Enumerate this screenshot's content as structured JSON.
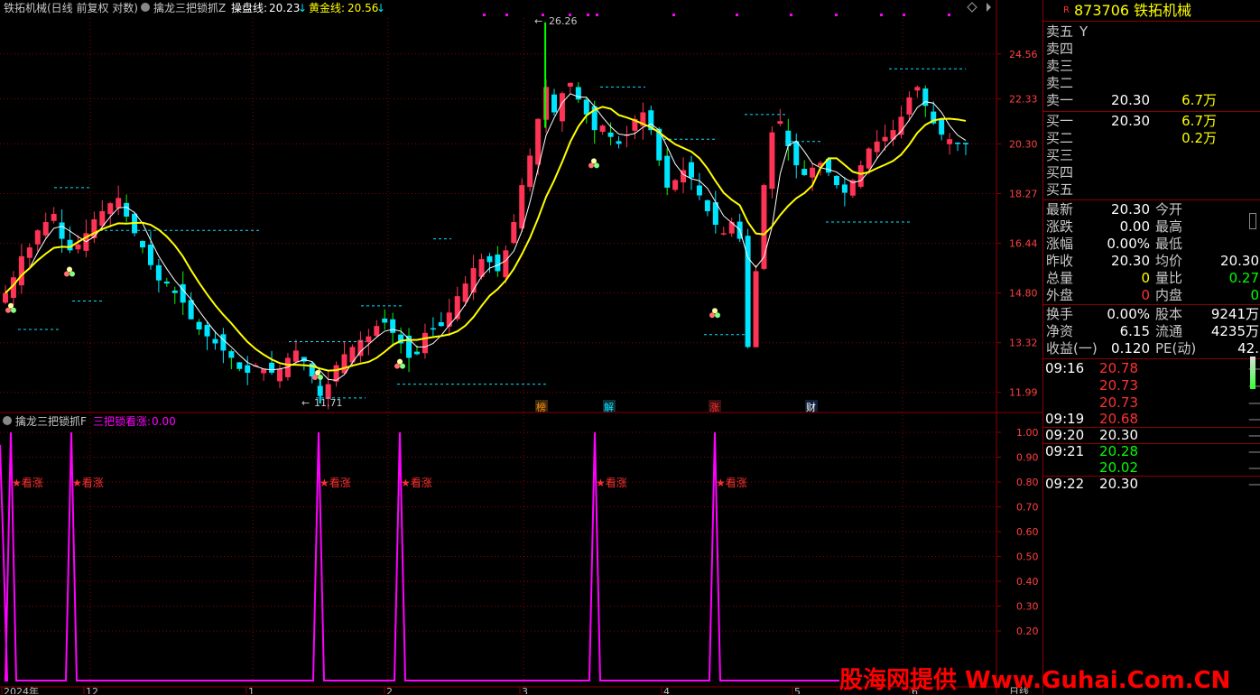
{
  "header": {
    "stock_title": "铁拓机械(日线 前复权 对数)",
    "indicator_name": "擒龙三把锁抓Z",
    "line1_label": "操盘线: ",
    "line1_value": "20.23",
    "line1_arrow": "↓",
    "line2_label": "黄金线: ",
    "line2_value": "20.56",
    "line2_arrow": "↓",
    "diamond_icon": "diamond-icon"
  },
  "sub_header": {
    "indicator_name": "擒龙三把锁抓F",
    "series_label": "三把锁看涨: ",
    "series_value": "0.00"
  },
  "price_axis": {
    "ticks": [
      "24.56",
      "22.33",
      "20.30",
      "18.27",
      "16.44",
      "14.80",
      "13.32",
      "11.99"
    ]
  },
  "sub_axis": {
    "ticks": [
      "1.00",
      "0.90",
      "0.80",
      "0.70",
      "0.60",
      "0.50",
      "0.40",
      "0.30",
      "0.20"
    ]
  },
  "annotations": {
    "high_label": "26.26",
    "low_label": "11.71",
    "events": [
      {
        "text": "榜",
        "color": "#ff8c00"
      },
      {
        "text": "解",
        "color": "#00e5ff"
      },
      {
        "text": "涨",
        "color": "#ff3030"
      },
      {
        "text": "财",
        "color": "#ffffff"
      }
    ],
    "signal_text": "★看涨"
  },
  "date_axis": {
    "labels": [
      "2024年",
      "12",
      "1",
      "2",
      "3",
      "4",
      "5",
      "6"
    ],
    "period": "日线"
  },
  "quote": {
    "badge": "R",
    "code": "873706",
    "name": "铁拓机械",
    "sell": [
      {
        "label": "卖五",
        "price": "",
        "vol": "",
        "extra": "Y"
      },
      {
        "label": "卖四",
        "price": "",
        "vol": ""
      },
      {
        "label": "卖三",
        "price": "",
        "vol": ""
      },
      {
        "label": "卖二",
        "price": "",
        "vol": ""
      },
      {
        "label": "卖一",
        "price": "20.30",
        "vol": "6.7万"
      }
    ],
    "buy": [
      {
        "label": "买一",
        "price": "20.30",
        "vol": "6.7万"
      },
      {
        "label": "买二",
        "price": "",
        "vol": "0.2万"
      },
      {
        "label": "买三",
        "price": "",
        "vol": ""
      },
      {
        "label": "买四",
        "price": "",
        "vol": ""
      },
      {
        "label": "买五",
        "price": "",
        "vol": ""
      }
    ],
    "stats": [
      {
        "l1": "最新",
        "v1": "20.30",
        "l2": "今开",
        "v2": ""
      },
      {
        "l1": "涨跌",
        "v1": "0.00",
        "l2": "最高",
        "v2": ""
      },
      {
        "l1": "涨幅",
        "v1": "0.00%",
        "l2": "最低",
        "v2": ""
      },
      {
        "l1": "昨收",
        "v1": "20.30",
        "l2": "均价",
        "v2": "20.30"
      },
      {
        "l1": "总量",
        "v1": "0",
        "l2": "量比",
        "v2": "0.27"
      },
      {
        "l1": "外盘",
        "v1": "0",
        "l2": "内盘",
        "v2": "0"
      }
    ],
    "stats2": [
      {
        "l1": "换手",
        "v1": "0.00%",
        "l2": "股本",
        "v2": "9241万"
      },
      {
        "l1": "净资",
        "v1": "6.15",
        "l2": "流通",
        "v2": "4235万"
      },
      {
        "l1": "收益(一)",
        "v1": "0.120",
        "l2": "PE(动)",
        "v2": "42."
      }
    ],
    "ticks": [
      {
        "time": "09:16",
        "price": "20.78"
      },
      {
        "time": "",
        "price": "20.73"
      },
      {
        "time": "",
        "price": "20.73"
      },
      {
        "time": "09:19",
        "price": "20.68"
      },
      {
        "time": "09:20",
        "price": "20.30"
      },
      {
        "time": "09:21",
        "price": "20.28"
      },
      {
        "time": "",
        "price": "20.02"
      },
      {
        "time": "09:22",
        "price": "20.30"
      }
    ]
  },
  "watermark": "股海网提供 Www.Guhai.Com.CN",
  "colors": {
    "up": "#ff3355",
    "down": "#00e5ff",
    "yellow": "#ffff00",
    "magenta": "#ff00ff",
    "red_text": "#ff3030",
    "green_text": "#00ff00",
    "grid": "#8b0000"
  },
  "chart_data": [
    {
      "type": "candlestick",
      "title": "擒龙三把锁抓Z",
      "scale": "log",
      "ylim": [
        11.6,
        26.5
      ],
      "y_ticks": [
        24.56,
        22.33,
        20.3,
        18.27,
        16.44,
        14.8,
        13.32,
        11.99
      ],
      "high_marker": 26.26,
      "low_marker": 11.71,
      "close_approx": [
        14.8,
        15.3,
        16.0,
        16.3,
        16.9,
        17.2,
        17.5,
        16.6,
        16.2,
        16.4,
        16.8,
        17.3,
        17.6,
        17.9,
        18.1,
        17.4,
        16.8,
        16.3,
        15.7,
        15.2,
        15.1,
        14.8,
        14.5,
        14.0,
        13.7,
        13.5,
        13.3,
        13.1,
        12.9,
        12.6,
        12.5,
        12.7,
        12.6,
        12.5,
        12.6,
        12.9,
        13.1,
        12.8,
        12.4,
        11.9,
        12.2,
        12.7,
        13.0,
        13.2,
        13.4,
        13.5,
        13.8,
        13.9,
        13.6,
        13.3,
        12.9,
        13.0,
        13.6,
        13.7,
        13.8,
        14.2,
        14.7,
        15.1,
        15.6,
        15.9,
        15.8,
        15.5,
        16.2,
        17.2,
        18.6,
        19.8,
        21.4,
        22.9,
        21.7,
        22.6,
        23.1,
        22.3,
        21.6,
        20.9,
        21.1,
        20.6,
        20.3,
        20.7,
        21.4,
        21.7,
        20.9,
        19.6,
        18.5,
        18.8,
        19.2,
        18.9,
        18.2,
        17.6,
        17.1,
        16.8,
        17.2,
        16.6,
        13.2,
        15.5,
        18.6,
        20.8,
        21.3,
        20.2,
        19.4,
        19.0,
        19.3,
        19.5,
        19.1,
        18.6,
        18.3,
        18.8,
        19.4,
        20.1,
        20.4,
        20.6,
        20.9,
        21.5,
        22.4,
        22.9,
        22.0,
        21.2,
        20.7,
        20.5,
        20.3,
        20.3
      ],
      "series": [
        {
          "name": "操盘线",
          "color": "#ffffff",
          "last": 20.23
        },
        {
          "name": "黄金线",
          "color": "#ffff00",
          "last": 20.56
        }
      ]
    },
    {
      "type": "line",
      "title": "擒龙三把锁抓F",
      "series": [
        {
          "name": "三把锁看涨",
          "color": "#ff00ff",
          "last": 0.0
        }
      ],
      "ylim": [
        0,
        1
      ],
      "y_ticks": [
        1.0,
        0.9,
        0.8,
        0.7,
        0.6,
        0.5,
        0.4,
        0.3,
        0.2
      ],
      "spike_count": 6,
      "spike_value": 1.0,
      "baseline_value": 0.0
    }
  ]
}
